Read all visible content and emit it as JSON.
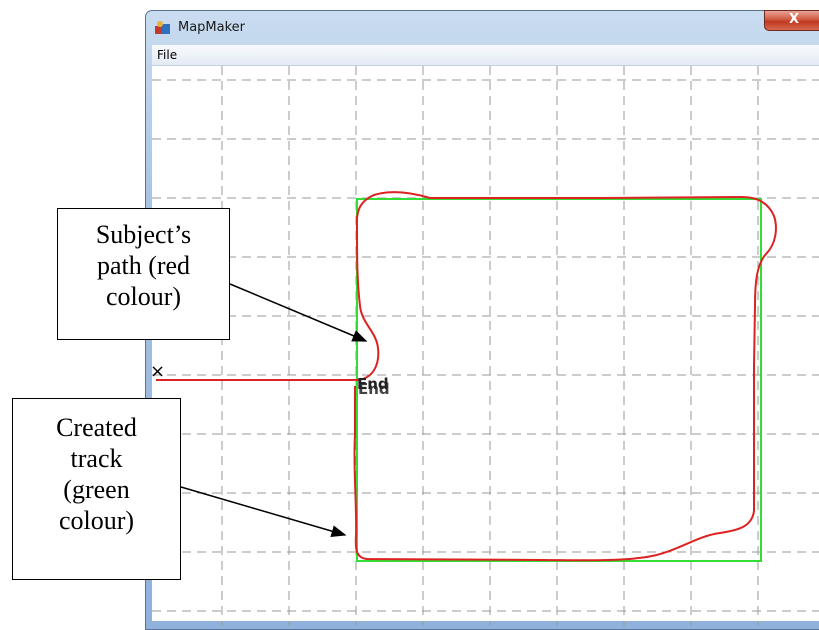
{
  "window": {
    "title": "MapMaker",
    "close_glyph": "X"
  },
  "menu": {
    "file": "File"
  },
  "map": {
    "start_marker": "×",
    "end_label_1": "End",
    "end_label_2": "End",
    "track_color": "#33dd33",
    "path_color": "#dd2222",
    "grid_color": "#9a9a9a"
  },
  "annotations": {
    "path_callout": [
      "Subject’s",
      "path (red",
      "colour)"
    ],
    "track_callout": [
      "Created",
      "track",
      "(green",
      "colour)"
    ]
  },
  "icons": {
    "app": "mapmaker-app-icon"
  }
}
